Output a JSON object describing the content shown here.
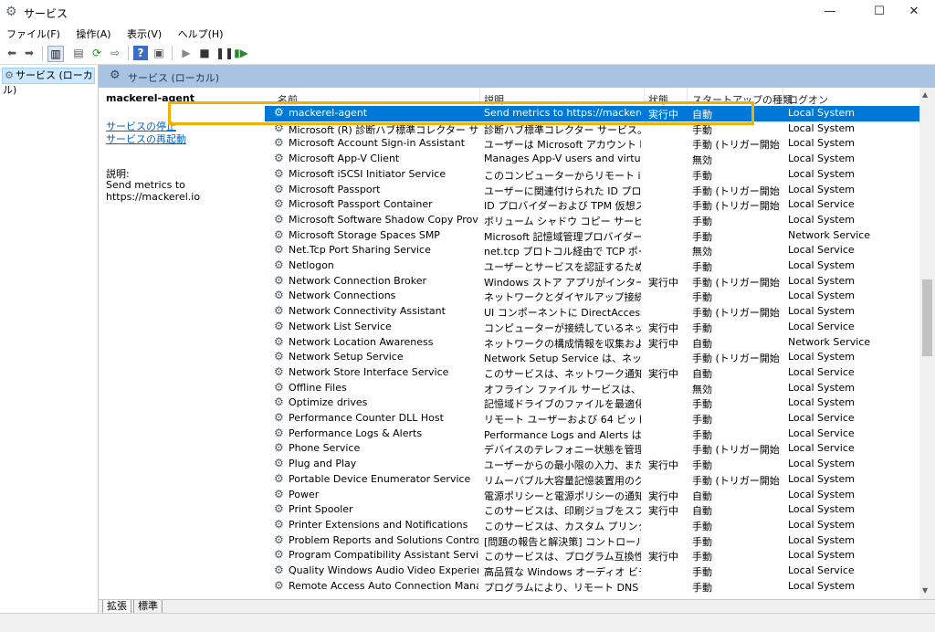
{
  "window": {
    "title": "サービス",
    "minimize": "—",
    "maximize": "☐",
    "close": "✕"
  },
  "menu": [
    "ファイル(F)",
    "操作(A)",
    "表示(V)",
    "ヘルプ(H)"
  ],
  "tree": {
    "label": "サービス (ローカル)"
  },
  "header": {
    "title": "サービス (ローカル)"
  },
  "desc_pane": {
    "service_name": "mackerel-agent",
    "links": [
      "サービスの停止",
      "サービスの再起動"
    ],
    "description_label": "説明:",
    "description": "Send metrics to https://mackerel.io"
  },
  "columns": [
    "名前",
    "説明",
    "状態",
    "スタートアップの種類",
    "ログオン"
  ],
  "rows": [
    {
      "name": "mackerel-agent",
      "desc": "Send metrics to https://mackerel.io",
      "status": "実行中",
      "startup": "自動",
      "logon": "Local System"
    },
    {
      "name": "Microsoft (R) 診断ハブ標準コレクター サービス",
      "desc": "診断ハブ標準コレクター サービス。実行…",
      "status": "",
      "startup": "手動",
      "logon": "Local System"
    },
    {
      "name": "Microsoft Account Sign-in Assistant",
      "desc": "ユーザーは Microsoft アカウント ID サー…",
      "status": "",
      "startup": "手動 (トリガー開始)",
      "logon": "Local System"
    },
    {
      "name": "Microsoft App-V Client",
      "desc": "Manages App-V users and virtual a…",
      "status": "",
      "startup": "無効",
      "logon": "Local System"
    },
    {
      "name": "Microsoft iSCSI Initiator Service",
      "desc": "このコンピューターからリモート iSCSI ター…",
      "status": "",
      "startup": "手動",
      "logon": "Local System"
    },
    {
      "name": "Microsoft Passport",
      "desc": "ユーザーに関連付けられた ID プロバイダ…",
      "status": "",
      "startup": "手動 (トリガー開始)",
      "logon": "Local System"
    },
    {
      "name": "Microsoft Passport Container",
      "desc": "ID プロバイダーおよび TPM 仮想スマー…",
      "status": "",
      "startup": "手動 (トリガー開始)",
      "logon": "Local Service"
    },
    {
      "name": "Microsoft Software Shadow Copy Provider",
      "desc": "ボリューム シャドウ コピー サービスによるソ…",
      "status": "",
      "startup": "手動",
      "logon": "Local System"
    },
    {
      "name": "Microsoft Storage Spaces SMP",
      "desc": "Microsoft 記憶域管理プロバイダーの…",
      "status": "",
      "startup": "手動",
      "logon": "Network Service"
    },
    {
      "name": "Net.Tcp Port Sharing Service",
      "desc": "net.tcp プロトコル経由で TCP ポートを…",
      "status": "",
      "startup": "無効",
      "logon": "Local Service"
    },
    {
      "name": "Netlogon",
      "desc": "ユーザーとサービスを認証するため、この…",
      "status": "",
      "startup": "手動",
      "logon": "Local System"
    },
    {
      "name": "Network Connection Broker",
      "desc": "Windows ストア アプリがインターネット…",
      "status": "実行中",
      "startup": "手動 (トリガー開始)",
      "logon": "Local System"
    },
    {
      "name": "Network Connections",
      "desc": "ネットワークとダイヤルアップ接続フォルダ…",
      "status": "",
      "startup": "手動",
      "logon": "Local System"
    },
    {
      "name": "Network Connectivity Assistant",
      "desc": "UI コンポーネントに DirectAccess の状…",
      "status": "",
      "startup": "手動 (トリガー開始)",
      "logon": "Local System"
    },
    {
      "name": "Network List Service",
      "desc": "コンピューターが接続しているネットワーク…",
      "status": "実行中",
      "startup": "手動",
      "logon": "Local Service"
    },
    {
      "name": "Network Location Awareness",
      "desc": "ネットワークの構成情報を収集および…",
      "status": "実行中",
      "startup": "自動",
      "logon": "Network Service"
    },
    {
      "name": "Network Setup Service",
      "desc": "Network Setup Service は、ネットワー…",
      "status": "",
      "startup": "手動 (トリガー開始)",
      "logon": "Local System"
    },
    {
      "name": "Network Store Interface Service",
      "desc": "このサービスは、ネットワーク通知 (インタ…",
      "status": "実行中",
      "startup": "自動",
      "logon": "Local Service"
    },
    {
      "name": "Offline Files",
      "desc": "オフライン ファイル サービスは、オフライン …",
      "status": "",
      "startup": "無効",
      "logon": "Local System"
    },
    {
      "name": "Optimize drives",
      "desc": "記憶域ドライブのファイルを最適化する…",
      "status": "",
      "startup": "手動",
      "logon": "Local System"
    },
    {
      "name": "Performance Counter DLL Host",
      "desc": "リモート ユーザーおよび 64 ビット プロセス…",
      "status": "",
      "startup": "手動",
      "logon": "Local Service"
    },
    {
      "name": "Performance Logs & Alerts",
      "desc": "Performance Logs and Alerts は、ス…",
      "status": "",
      "startup": "手動",
      "logon": "Local Service"
    },
    {
      "name": "Phone Service",
      "desc": "デバイスのテレフォニー状態を管理します",
      "status": "",
      "startup": "手動 (トリガー開始)",
      "logon": "Local Service"
    },
    {
      "name": "Plug and Play",
      "desc": "ユーザーからの最小限の入力、または入…",
      "status": "実行中",
      "startup": "手動",
      "logon": "Local System"
    },
    {
      "name": "Portable Device Enumerator Service",
      "desc": "リムーバブル大容量記憶装置用のグル…",
      "status": "",
      "startup": "手動 (トリガー開始)",
      "logon": "Local System"
    },
    {
      "name": "Power",
      "desc": "電源ポリシーと電源ポリシーの通知配…",
      "status": "実行中",
      "startup": "自動",
      "logon": "Local System"
    },
    {
      "name": "Print Spooler",
      "desc": "このサービスは、印刷ジョブをスプールし、…",
      "status": "実行中",
      "startup": "自動",
      "logon": "Local System"
    },
    {
      "name": "Printer Extensions and Notifications",
      "desc": "このサービスは、カスタム プリンターのダイ…",
      "status": "",
      "startup": "手動",
      "logon": "Local System"
    },
    {
      "name": "Problem Reports and Solutions Control Pa…",
      "desc": "[問題の報告と解決策] コントロール パ…",
      "status": "",
      "startup": "手動",
      "logon": "Local System"
    },
    {
      "name": "Program Compatibility Assistant Service",
      "desc": "このサービスは、プログラム互換性アシス…",
      "status": "実行中",
      "startup": "手動",
      "logon": "Local System"
    },
    {
      "name": "Quality Windows Audio Video Experience",
      "desc": "高品質な Windows オーディオ ビデオ エ…",
      "status": "",
      "startup": "手動",
      "logon": "Local Service"
    },
    {
      "name": "Remote Access Auto Connection Manager",
      "desc": "プログラムにより、リモート DNS 名やリモ…",
      "status": "",
      "startup": "手動",
      "logon": "Local System"
    }
  ],
  "tabs": [
    "拡張",
    "標準"
  ]
}
